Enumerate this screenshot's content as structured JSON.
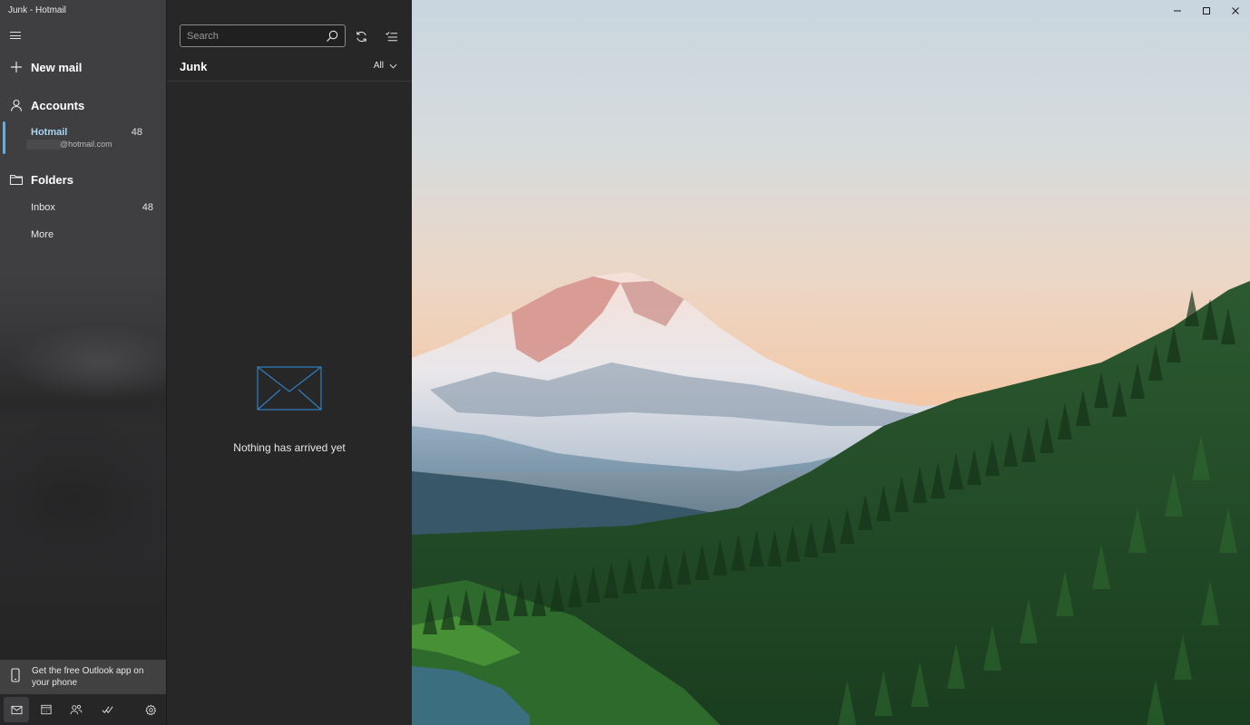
{
  "window": {
    "title": "Junk - Hotmail"
  },
  "nav": {
    "new_mail": "New mail",
    "accounts_header": "Accounts",
    "account": {
      "name": "Hotmail",
      "count": "48",
      "email_suffix": "@hotmail.com"
    },
    "folders_header": "Folders",
    "folders": [
      {
        "name": "Inbox",
        "count": "48"
      },
      {
        "name": "More",
        "count": ""
      }
    ],
    "promo": "Get the free Outlook app on your phone",
    "bottom_icons": [
      "mail-icon",
      "calendar-icon",
      "people-icon",
      "todo-icon",
      "settings-icon"
    ]
  },
  "list": {
    "search_placeholder": "Search",
    "folder_title": "Junk",
    "filter_label": "All",
    "empty_message": "Nothing has arrived yet"
  },
  "colors": {
    "accent": "#5bb1ea",
    "nav_bg": "#3f3f41",
    "list_bg": "#272728"
  }
}
